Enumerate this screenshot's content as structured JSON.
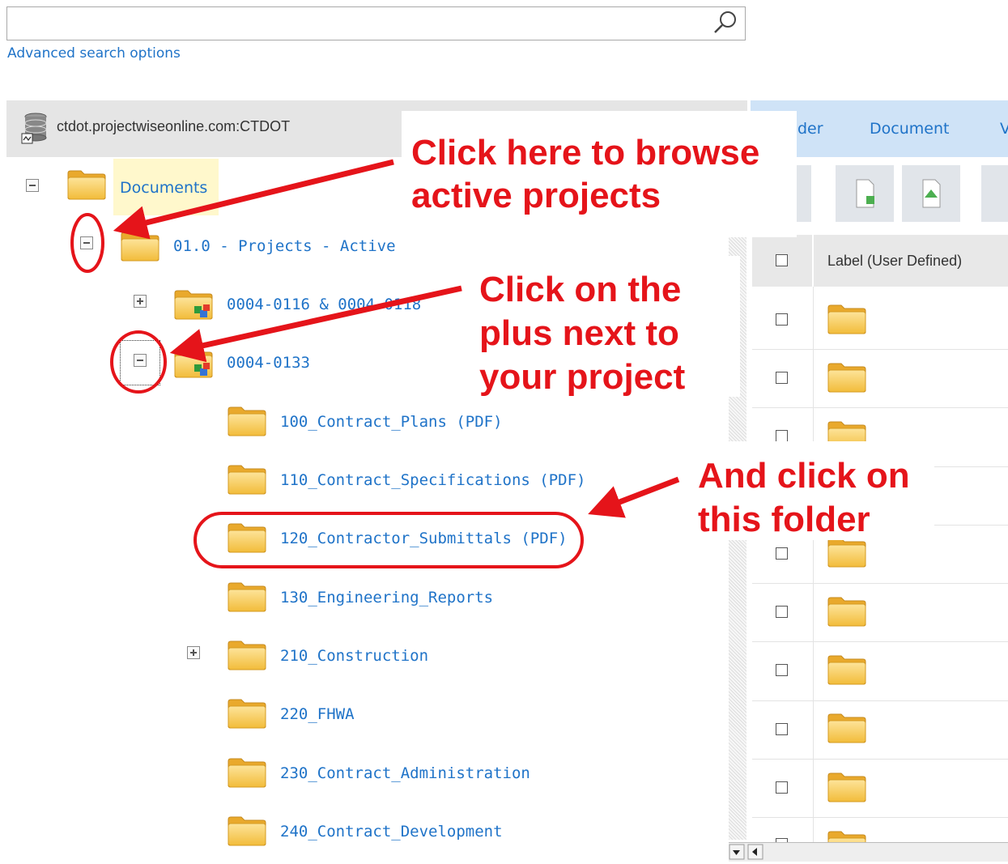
{
  "search": {
    "value": "",
    "placeholder": "",
    "advanced_link": "Advanced search options"
  },
  "datasource": {
    "name": "ctdot.projectwiseonline.com:CTDOT"
  },
  "tree": {
    "root": "Documents",
    "projects_active": "01.0 - Projects - Active",
    "project_a": "0004-0116 & 0004-0118",
    "project_b": "0004-0133",
    "subfolders": [
      "100_Contract_Plans (PDF)",
      "110_Contract_Specifications (PDF)",
      "120_Contractor_Submittals (PDF)",
      "130_Engineering_Reports",
      "210_Construction",
      "220_FHWA",
      "230_Contract_Administration",
      "240_Contract_Development"
    ]
  },
  "right_panel": {
    "tabs": [
      "der",
      "Document",
      "V"
    ],
    "column_header": "Label (User Defined)"
  },
  "callouts": {
    "browse_line1": "Click here to browse",
    "browse_line2": "active projects",
    "plus_line1": "Click on the",
    "plus_line2": "plus next to",
    "plus_line3": "your project",
    "folder_line1": "And click on",
    "folder_line2": "this folder"
  },
  "colors": {
    "link": "#1f73c8",
    "callout": "#e5141a",
    "folder": "#f5c84c"
  },
  "icons": [
    "search-icon",
    "database-icon",
    "folder-icon",
    "project-folder-icon",
    "expand-icon",
    "collapse-icon"
  ]
}
